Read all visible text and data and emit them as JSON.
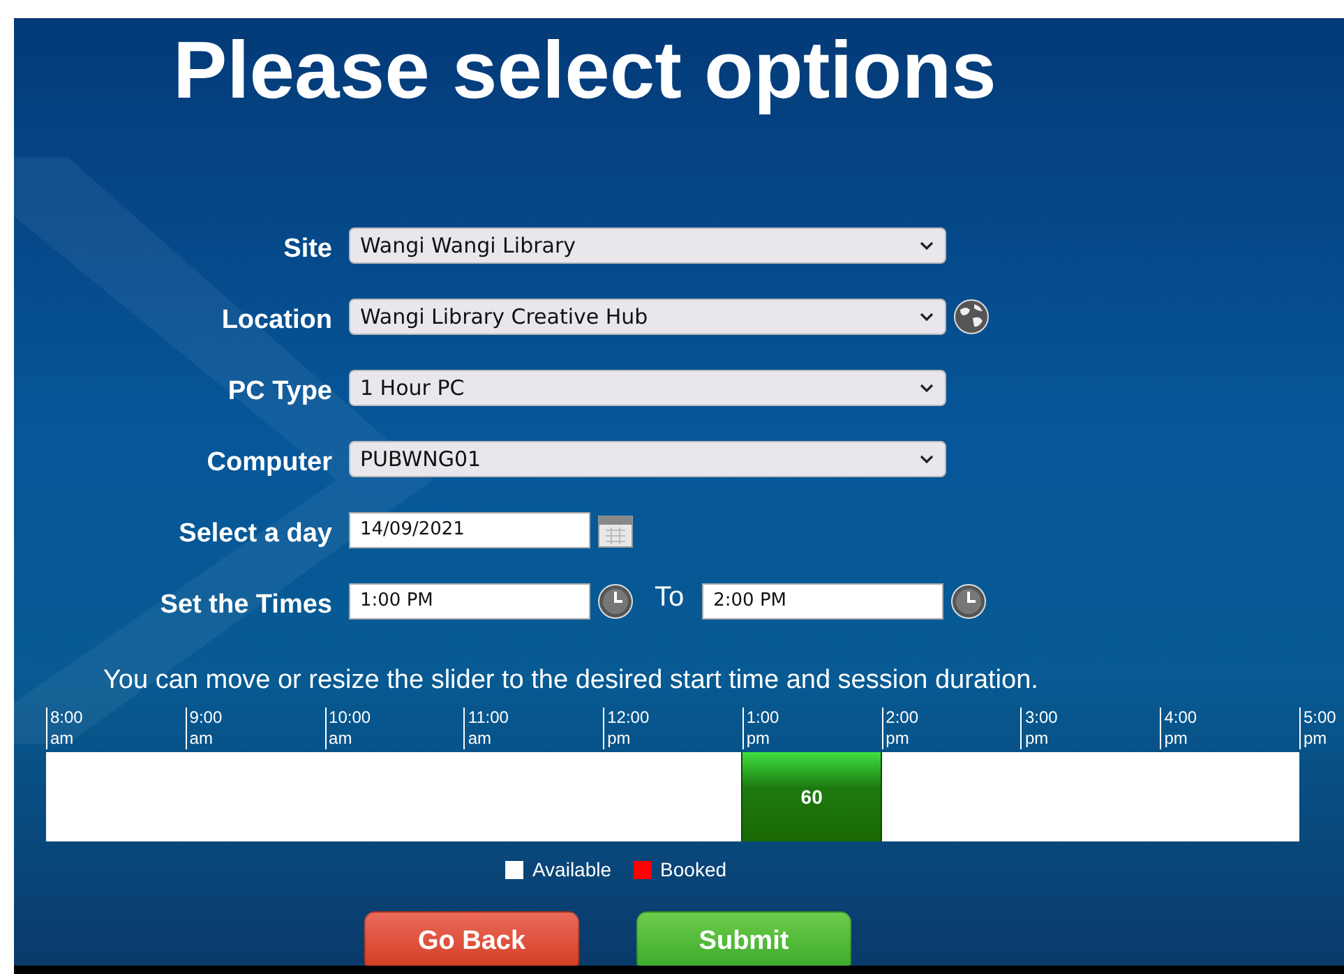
{
  "title": "Please select options",
  "fields": [
    {
      "label": "Site",
      "kind": "select",
      "value": "Wangi Wangi Library"
    },
    {
      "label": "Location",
      "kind": "select",
      "value": "Wangi Library Creative Hub",
      "globe": true
    },
    {
      "label": "PC Type",
      "kind": "select",
      "value": "1 Hour PC"
    },
    {
      "label": "Computer",
      "kind": "select",
      "value": "PUBWNG01"
    },
    {
      "label": "Select a day",
      "kind": "date",
      "value": "14/09/2021"
    },
    {
      "label": "Set the Times",
      "kind": "times",
      "value": "1:00 PM",
      "separator": "To",
      "end_value": "2:00 PM"
    }
  ],
  "instructions": "You can move or resize the slider to the desired start time and session duration.",
  "timeline": {
    "ticks": [
      {
        "time": "8:00",
        "period": "am"
      },
      {
        "time": "9:00",
        "period": "am"
      },
      {
        "time": "10:00",
        "period": "am"
      },
      {
        "time": "11:00",
        "period": "am"
      },
      {
        "time": "12:00",
        "period": "pm"
      },
      {
        "time": "1:00",
        "period": "pm"
      },
      {
        "time": "2:00",
        "period": "pm"
      },
      {
        "time": "3:00",
        "period": "pm"
      },
      {
        "time": "4:00",
        "period": "pm"
      },
      {
        "time": "5:00",
        "period": "pm"
      }
    ],
    "slots": [
      {
        "selected": false
      },
      {
        "selected": false
      },
      {
        "selected": false
      },
      {
        "selected": false
      },
      {
        "selected": false
      },
      {
        "selected": true
      },
      {
        "selected": false
      },
      {
        "selected": false
      },
      {
        "selected": false
      }
    ],
    "slider_label": "60"
  },
  "legend": [
    {
      "label": "Available",
      "color": "#ffffff"
    },
    {
      "label": "Booked",
      "color": "#ff0000"
    }
  ],
  "buttons": [
    {
      "label": "Go Back",
      "kind": "back"
    },
    {
      "label": "Submit",
      "kind": "submit"
    }
  ]
}
